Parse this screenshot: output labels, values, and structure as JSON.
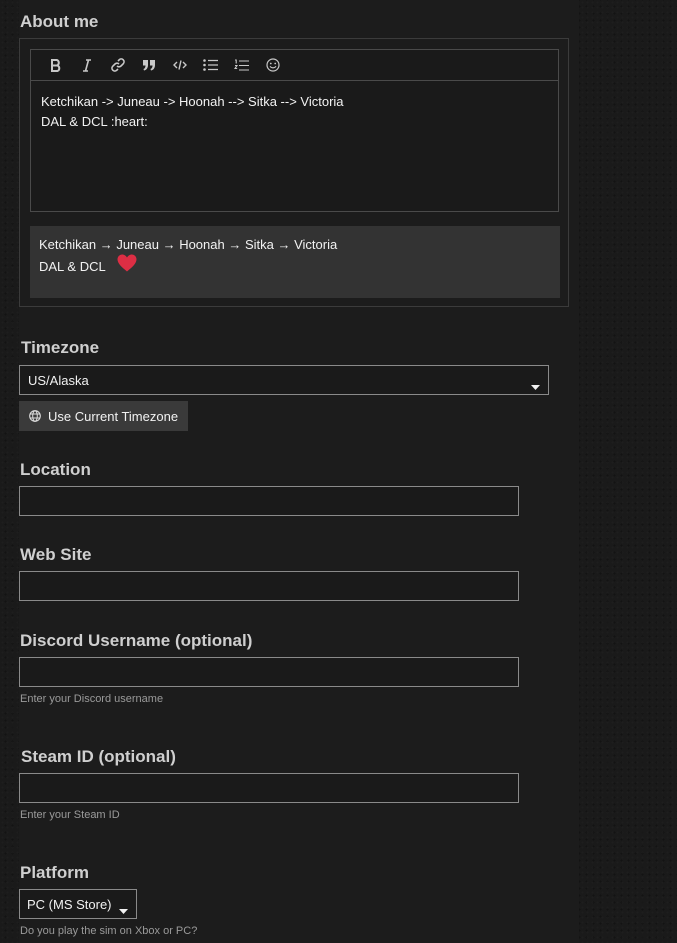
{
  "about": {
    "label": "About me",
    "toolbar_icons": [
      "bold-icon",
      "italic-icon",
      "link-icon",
      "quote-icon",
      "code-icon",
      "bullet-list-icon",
      "numbered-list-icon",
      "emoji-icon"
    ],
    "editor_line1": "Ketchikan -> Juneau -> Hoonah --> Sitka --> Victoria",
    "editor_line2": "DAL & DCL :heart:",
    "preview_line1": "Ketchikan → Juneau → Hoonah → Sitka → Victoria",
    "preview_line2": "DAL & DCL",
    "heart_color": "#dd2e44"
  },
  "timezone": {
    "label": "Timezone",
    "value": "US/Alaska",
    "button_label": "Use Current Timezone"
  },
  "location": {
    "label": "Location",
    "value": ""
  },
  "website": {
    "label": "Web Site",
    "value": ""
  },
  "discord": {
    "label": "Discord Username (optional)",
    "value": "",
    "help": "Enter your Discord username"
  },
  "steam": {
    "label": "Steam ID (optional)",
    "value": "",
    "help": "Enter your Steam ID"
  },
  "platform": {
    "label": "Platform",
    "value": "PC (MS Store)",
    "help": "Do you play the sim on Xbox or PC?"
  },
  "colors": {
    "background": "#1c1c1c",
    "preview_bg": "#333333",
    "button_bg": "#3a3a3a",
    "border": "#8a8a8a"
  }
}
